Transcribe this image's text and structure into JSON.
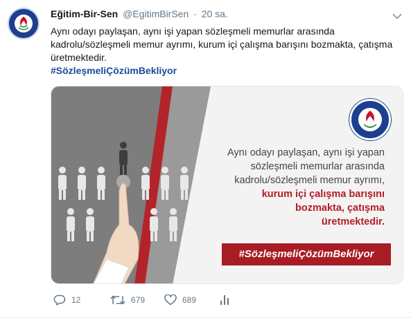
{
  "author": {
    "name": "Eğitim-Bir-Sen",
    "handle": "@EgitimBirSen",
    "separator": "·",
    "time": "20 sa."
  },
  "tweet": {
    "text": "Aynı odayı paylaşan, aynı işi yapan sözleşmeli memurlar arasında kadrolu/sözleşmeli memur ayrımı,  kurum içi çalışma barışını bozmakta, çatışma üretmektedir.",
    "hashtag": "#SözleşmeliÇözümBekliyor"
  },
  "media": {
    "overlay_lines": [
      "Aynı odayı paylaşan, aynı işi yapan",
      "sözleşmeli memurlar arasında",
      "kadrolu/sözleşmeli memur ayrımı,"
    ],
    "overlay_bold_lines": [
      "kurum içi çalışma barışını",
      "bozmakta, çatışma",
      "üretmektedir."
    ],
    "banner": "#SözleşmeliÇözümBekliyor",
    "logo_text": "EĞİTİM-BİR-SEN"
  },
  "actions": {
    "reply_count": "12",
    "retweet_count": "679",
    "like_count": "689"
  },
  "icons": {
    "reply": "reply-icon",
    "retweet": "retweet-icon",
    "like": "heart-icon",
    "analytics": "analytics-icon",
    "menu": "chevron-down-icon"
  },
  "colors": {
    "brand_blue": "#1d3f8f",
    "accent_red": "#a81c23",
    "muted": "#657786"
  }
}
